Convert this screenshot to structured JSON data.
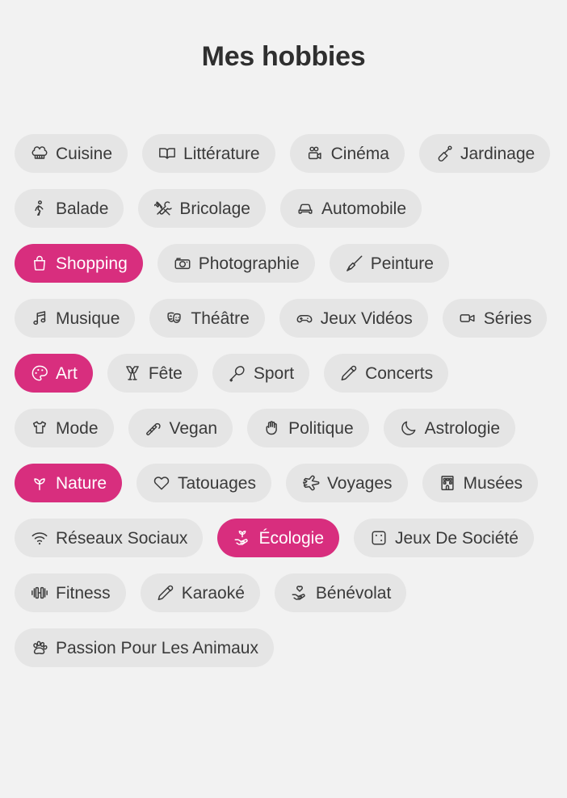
{
  "header": {
    "title": "Mes hobbies"
  },
  "colors": {
    "page_background": "#f2f2f2",
    "chip_background": "#e5e5e5",
    "chip_text": "#3a3a3a",
    "selected_background": "#d82e7e",
    "selected_text": "#ffffff",
    "title_text": "#2f2f2f"
  },
  "hobbies": [
    {
      "label": "Cuisine",
      "icon": "chef-hat-icon",
      "selected": false
    },
    {
      "label": "Littérature",
      "icon": "open-book-icon",
      "selected": false
    },
    {
      "label": "Cinéma",
      "icon": "film-camera-icon",
      "selected": false
    },
    {
      "label": "Jardinage",
      "icon": "shovel-icon",
      "selected": false
    },
    {
      "label": "Balade",
      "icon": "walking-person-icon",
      "selected": false
    },
    {
      "label": "Bricolage",
      "icon": "tools-icon",
      "selected": false
    },
    {
      "label": "Automobile",
      "icon": "car-icon",
      "selected": false
    },
    {
      "label": "Shopping",
      "icon": "shopping-bag-icon",
      "selected": true
    },
    {
      "label": "Photographie",
      "icon": "camera-icon",
      "selected": false
    },
    {
      "label": "Peinture",
      "icon": "paintbrush-icon",
      "selected": false
    },
    {
      "label": "Musique",
      "icon": "music-note-icon",
      "selected": false
    },
    {
      "label": "Théâtre",
      "icon": "theater-masks-icon",
      "selected": false
    },
    {
      "label": "Jeux Vidéos",
      "icon": "gamepad-icon",
      "selected": false
    },
    {
      "label": "Séries",
      "icon": "video-camera-icon",
      "selected": false
    },
    {
      "label": "Art",
      "icon": "palette-icon",
      "selected": true
    },
    {
      "label": "Fête",
      "icon": "champagne-glasses-icon",
      "selected": false
    },
    {
      "label": "Sport",
      "icon": "racket-icon",
      "selected": false
    },
    {
      "label": "Concerts",
      "icon": "microphone-icon",
      "selected": false
    },
    {
      "label": "Mode",
      "icon": "tshirt-icon",
      "selected": false
    },
    {
      "label": "Vegan",
      "icon": "carrot-icon",
      "selected": false
    },
    {
      "label": "Politique",
      "icon": "raised-fist-icon",
      "selected": false
    },
    {
      "label": "Astrologie",
      "icon": "crescent-moon-icon",
      "selected": false
    },
    {
      "label": "Nature",
      "icon": "sprout-icon",
      "selected": true
    },
    {
      "label": "Tatouages",
      "icon": "heart-icon",
      "selected": false
    },
    {
      "label": "Voyages",
      "icon": "airplane-icon",
      "selected": false
    },
    {
      "label": "Musées",
      "icon": "museum-building-icon",
      "selected": false
    },
    {
      "label": "Réseaux Sociaux",
      "icon": "wifi-icon",
      "selected": false
    },
    {
      "label": "Écologie",
      "icon": "hand-sprout-icon",
      "selected": true
    },
    {
      "label": "Jeux De Société",
      "icon": "dice-icon",
      "selected": false
    },
    {
      "label": "Fitness",
      "icon": "dumbbell-icon",
      "selected": false
    },
    {
      "label": "Karaoké",
      "icon": "microphone-icon",
      "selected": false
    },
    {
      "label": "Bénévolat",
      "icon": "hand-heart-icon",
      "selected": false
    },
    {
      "label": "Passion Pour Les Animaux",
      "icon": "paw-print-icon",
      "selected": false
    }
  ]
}
